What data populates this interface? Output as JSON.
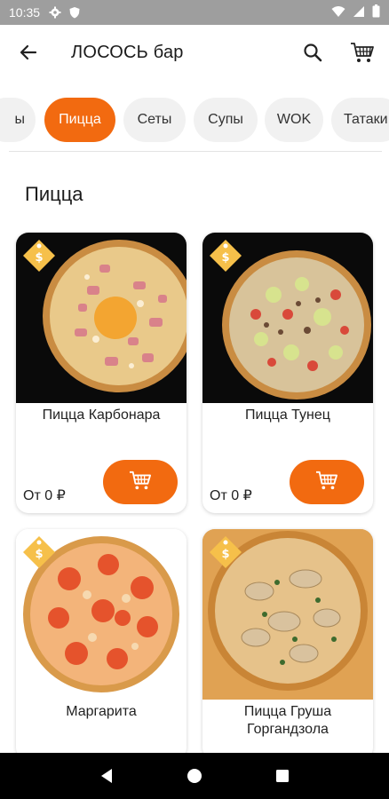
{
  "status_bar": {
    "time": "10:35",
    "icons": [
      "gear-icon",
      "shield-icon",
      "wifi-icon",
      "signal-icon",
      "battery-icon"
    ]
  },
  "app_bar": {
    "title": "ЛОСОСЬ бар",
    "back_icon": "arrow-left-icon",
    "search_icon": "search-icon",
    "cart_icon": "shopping-cart-icon"
  },
  "categories": [
    {
      "label": "ы",
      "active": false
    },
    {
      "label": "Пицца",
      "active": true
    },
    {
      "label": "Сеты",
      "active": false
    },
    {
      "label": "Супы",
      "active": false
    },
    {
      "label": "WOK",
      "active": false
    },
    {
      "label": "Татаки",
      "active": false
    }
  ],
  "section": {
    "title": "Пицца"
  },
  "products": [
    {
      "name": "Пицца Карбонара",
      "price": "От 0 ₽",
      "tag_icon": "sale-tag-icon"
    },
    {
      "name": "Пицца Тунец",
      "price": "От 0 ₽",
      "tag_icon": "sale-tag-icon"
    },
    {
      "name": "Маргарита",
      "price": "",
      "tag_icon": "sale-tag-icon"
    },
    {
      "name": "Пицца Груша Горгандзола",
      "price": "",
      "tag_icon": "sale-tag-icon"
    }
  ],
  "colors": {
    "accent": "#f26a10",
    "tag": "#f6c04a",
    "chip_bg": "#f1f1f1",
    "status_bar": "#9e9e9e"
  },
  "nav_bar": {
    "icons": [
      "back-triangle-icon",
      "home-circle-icon",
      "recents-square-icon"
    ]
  }
}
